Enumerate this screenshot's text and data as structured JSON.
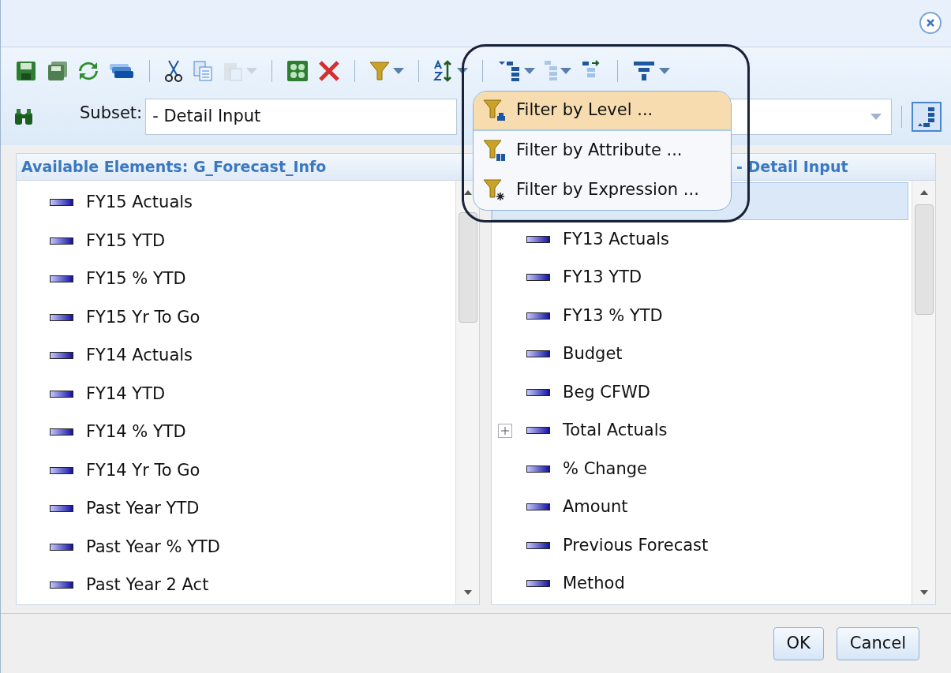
{
  "subset": {
    "label": "Subset:",
    "value": "- Detail Input"
  },
  "filter_menu": {
    "items": [
      {
        "label": "Filter by Level ...",
        "selected": true
      },
      {
        "label": "Filter by Attribute ...",
        "selected": false
      },
      {
        "label": "Filter by Expression ...",
        "selected": false
      }
    ]
  },
  "available": {
    "title": "Available Elements: G_Forecast_Info",
    "items": [
      {
        "label": "FY15 Actuals"
      },
      {
        "label": "FY15 YTD"
      },
      {
        "label": "FY15 % YTD"
      },
      {
        "label": "FY15 Yr To Go"
      },
      {
        "label": "FY14 Actuals"
      },
      {
        "label": "FY14 YTD"
      },
      {
        "label": "FY14 % YTD"
      },
      {
        "label": "FY14 Yr To Go"
      },
      {
        "label": "Past Year YTD"
      },
      {
        "label": "Past Year % YTD"
      },
      {
        "label": "Past Year 2 Act"
      }
    ]
  },
  "current": {
    "title": "- Detail Input",
    "items": [
      {
        "selected": true
      },
      {
        "label": "FY13 Actuals",
        "selected": false
      },
      {
        "label": "FY13 YTD",
        "selected": false
      },
      {
        "label": "FY13 % YTD",
        "selected": false
      },
      {
        "label": "Budget",
        "selected": false
      },
      {
        "label": "Beg CFWD",
        "selected": false
      },
      {
        "label": "Total Actuals",
        "selected": false,
        "expanded": false
      },
      {
        "label": "% Change",
        "selected": false
      },
      {
        "label": "Amount",
        "selected": false
      },
      {
        "label": "Previous Forecast",
        "selected": false
      },
      {
        "label": "Method",
        "selected": false
      }
    ]
  },
  "buttons": [
    "OK",
    "Cancel"
  ]
}
